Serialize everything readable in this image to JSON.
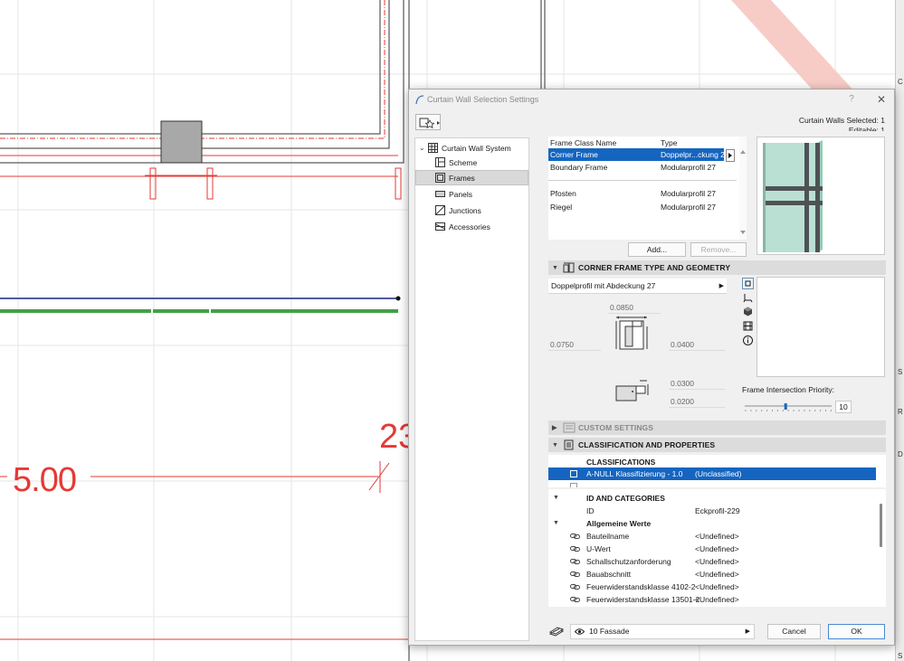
{
  "canvas": {
    "dimension_left": "5.00",
    "dimension_right": "23"
  },
  "right_strip": {
    "labels": [
      "C",
      "S",
      "R",
      "D",
      "S"
    ]
  },
  "dialog": {
    "title": "Curtain Wall Selection Settings",
    "help_glyph": "?",
    "close_glyph": "✕",
    "selected_label": "Curtain Walls Selected: 1",
    "editable_label": "Editable: 1"
  },
  "tree": {
    "root": "Curtain Wall System",
    "items": [
      "Scheme",
      "Frames",
      "Panels",
      "Junctions",
      "Accessories"
    ],
    "selected": "Frames"
  },
  "frame_list": {
    "col_name": "Frame Class Name",
    "col_type": "Type",
    "rows": [
      {
        "name": "Corner Frame",
        "type": "Doppelpr...ckung 27",
        "selected": true
      },
      {
        "name": "Boundary Frame",
        "type": "Modularprofil 27",
        "selected": false
      },
      {
        "name": "Pfosten",
        "type": "Modularprofil 27",
        "selected": false
      },
      {
        "name": "Riegel",
        "type": "Modularprofil 27",
        "selected": false
      }
    ],
    "add_label": "Add...",
    "remove_label": "Remove..."
  },
  "geometry": {
    "section_title": "CORNER FRAME TYPE AND GEOMETRY",
    "profile": "Doppelprofil mit Abdeckung 27",
    "width": "0.0850",
    "left_depth": "0.0750",
    "right_depth": "0.0400",
    "cap_width": "0.0300",
    "cap_depth": "0.0200",
    "priority_label": "Frame Intersection Priority:",
    "priority_value": "10",
    "priority_fraction": 0.47
  },
  "custom_settings": {
    "title": "CUSTOM SETTINGS"
  },
  "classification": {
    "title": "CLASSIFICATION AND PROPERTIES",
    "header": "CLASSIFICATIONS",
    "row_name": "A-NULL Klassifizierung - 1.0",
    "row_value": "(Unclassified)"
  },
  "properties": {
    "id_group": "ID AND CATEGORIES",
    "id_key": "ID",
    "id_value": "Eckprofil-229",
    "general_group": "Allgemeine Werte",
    "rows": [
      {
        "key": "Bauteilname",
        "value": "<Undefined>"
      },
      {
        "key": "U-Wert",
        "value": "<Undefined>"
      },
      {
        "key": "Schallschutzanforderung",
        "value": "<Undefined>"
      },
      {
        "key": "Bauabschnitt",
        "value": "<Undefined>"
      },
      {
        "key": "Feuerwiderstandsklasse 4102-2",
        "value": "<Undefined>"
      },
      {
        "key": "Feuerwiderstandsklasse 13501-2",
        "value": "<Undefined>"
      }
    ]
  },
  "footer": {
    "layer": "10 Fassade",
    "cancel_label": "Cancel",
    "ok_label": "OK"
  },
  "colors": {
    "selection": "#1565c0",
    "plan_red": "#e53935",
    "plan_blue": "#1a237e",
    "plan_green": "#43a047",
    "glass": "#b9e0d3",
    "mullion": "#4f5254"
  }
}
